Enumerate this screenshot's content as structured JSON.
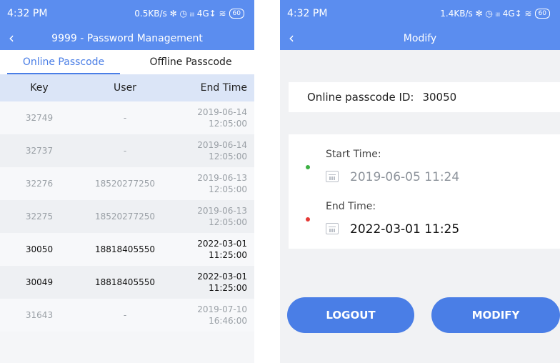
{
  "left": {
    "status": {
      "time": "4:32 PM",
      "indicators": "0.5KB/s ✻ ◷ ᵢₗₗ 4G↕ ≋",
      "battery": "60"
    },
    "title": "9999 - Password Management",
    "tabs": [
      {
        "label": "Online Passcode",
        "active": true
      },
      {
        "label": "Offline Passcode",
        "active": false
      }
    ],
    "columns": [
      "Key",
      "User",
      "End Time"
    ],
    "rows": [
      {
        "key": "32749",
        "user": "-",
        "date": "2019-06-14",
        "time": "12:05:00",
        "active": false
      },
      {
        "key": "32737",
        "user": "-",
        "date": "2019-06-14",
        "time": "12:05:00",
        "active": false
      },
      {
        "key": "32276",
        "user": "18520277250",
        "date": "2019-06-13",
        "time": "12:05:00",
        "active": false
      },
      {
        "key": "32275",
        "user": "18520277250",
        "date": "2019-06-13",
        "time": "12:05:00",
        "active": false
      },
      {
        "key": "30050",
        "user": "18818405550",
        "date": "2022-03-01",
        "time": "11:25:00",
        "active": true
      },
      {
        "key": "30049",
        "user": "18818405550",
        "date": "2022-03-01",
        "time": "11:25:00",
        "active": true
      },
      {
        "key": "31643",
        "user": "-",
        "date": "2019-07-10",
        "time": "16:46:00",
        "active": false
      }
    ]
  },
  "right": {
    "status": {
      "time": "4:32 PM",
      "indicators": "1.4KB/s ✻ ◷ ᵢₗₗ 4G↕ ≋",
      "battery": "60"
    },
    "title": "Modify",
    "id_label": "Online passcode ID:",
    "id_value": "30050",
    "start_label": "Start Time:",
    "start_value": "2019-06-05 11:24",
    "end_label": "End Time:",
    "end_value": "2022-03-01 11:25",
    "logout_label": "LOGOUT",
    "modify_label": "MODIFY"
  },
  "colors": {
    "primary": "#5b8def",
    "button": "#4a7ee6",
    "start_dot": "#3cb043",
    "end_dot": "#e53935"
  }
}
